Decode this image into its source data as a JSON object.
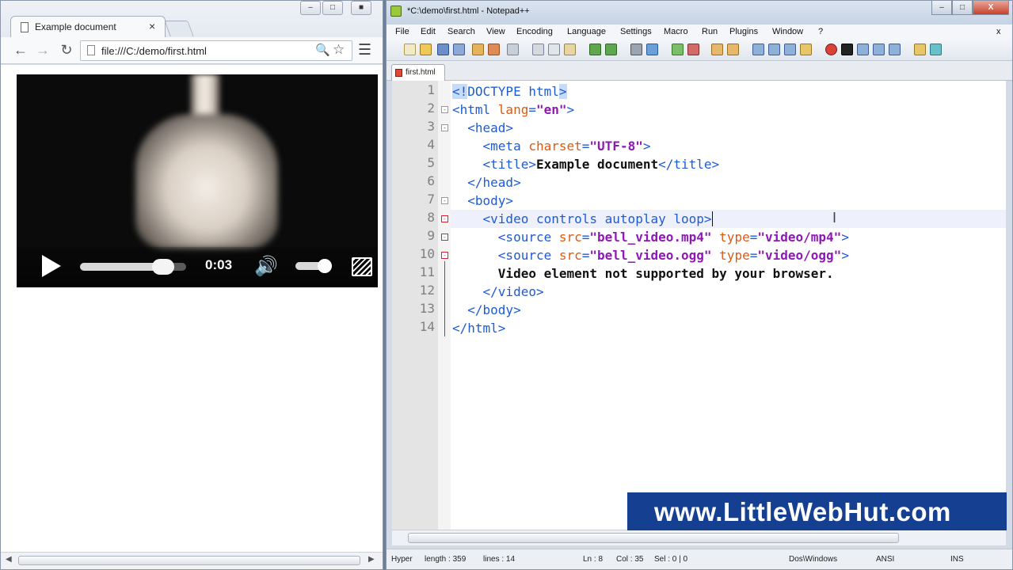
{
  "browser": {
    "tab_title": "Example document",
    "tab_close": "×",
    "url": "file:///C:/demo/first.html",
    "video": {
      "time": "0:03",
      "seek_progress": 0.78,
      "volume_level": 0.8
    }
  },
  "notepad": {
    "title": "*C:\\demo\\first.html - Notepad++",
    "menu": [
      "File",
      "Edit",
      "Search",
      "View",
      "Encoding",
      "Language",
      "Settings",
      "Macro",
      "Run",
      "Plugins",
      "Window",
      "?"
    ],
    "menu_close": "x",
    "file_tab": "first.html",
    "line_numbers": [
      "1",
      "2",
      "3",
      "4",
      "5",
      "6",
      "7",
      "8",
      "9",
      "10",
      "11",
      "12",
      "13",
      "14"
    ],
    "code": {
      "l1_hl": "<!",
      "l1_rest": "DOCTYPE html",
      "l1_end": ">",
      "l2_open": "<html ",
      "l2_attr": "lang",
      "l2_eq": "=",
      "l2_val": "\"en\"",
      "l2_close": ">",
      "l3": "<head>",
      "l4_open": "<meta ",
      "l4_attr": "charset",
      "l4_eq": "=",
      "l4_val": "\"UTF-8\"",
      "l4_close": ">",
      "l5_open": "<title>",
      "l5_text": "Example document",
      "l5_close": "</title>",
      "l6": "</head>",
      "l7": "<body>",
      "l8": "<video controls autoplay loop>",
      "l9_open": "<source ",
      "l9_attr1": "src",
      "l9_val1": "\"bell_video.mp4\"",
      "l9_attr2": "type",
      "l9_val2": "\"video/mp4\"",
      "l9_close": ">",
      "l10_open": "<source ",
      "l10_attr1": "src",
      "l10_val1": "\"bell_video.ogg\"",
      "l10_attr2": "type",
      "l10_val2": "\"video/ogg\"",
      "l10_close": ">",
      "l11": "Video element not supported by your browser.",
      "l12": "</video>",
      "l13": "</body>",
      "l14": "</html>"
    },
    "status": {
      "type": "Hyper",
      "length": "length : 359",
      "lines": "lines : 14",
      "ln": "Ln : 8",
      "col": "Col : 35",
      "sel": "Sel : 0 | 0",
      "eol": "Dos\\Windows",
      "encoding": "ANSI",
      "mode": "INS"
    }
  },
  "banner": {
    "text": "www.LittleWebHut.com"
  }
}
